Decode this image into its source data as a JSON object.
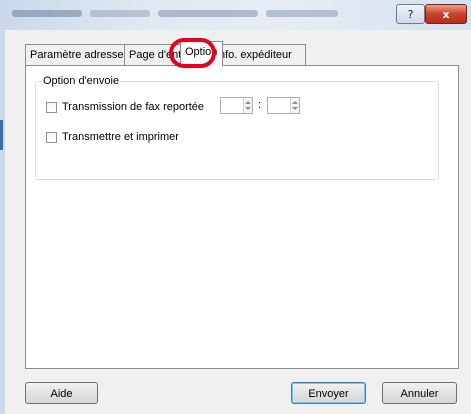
{
  "window": {
    "title": "",
    "help_label": "?",
    "close_label": "x"
  },
  "tabs": [
    {
      "label": "Paramètre adresse"
    },
    {
      "label": "Page d'entê"
    },
    {
      "label": "Option"
    },
    {
      "label": "nfo. expéditeur"
    }
  ],
  "annotation": {
    "color": "#e8001c"
  },
  "group": {
    "title": "Option d'envoie",
    "deferred_fax_label": "Transmission de fax reportée",
    "deferred_fax_checked": false,
    "time_separator": ":",
    "send_and_print_label": "Transmettre et imprimer",
    "send_and_print_checked": false
  },
  "buttons": {
    "help": "Aide",
    "send": "Envoyer",
    "cancel": "Annuler"
  }
}
